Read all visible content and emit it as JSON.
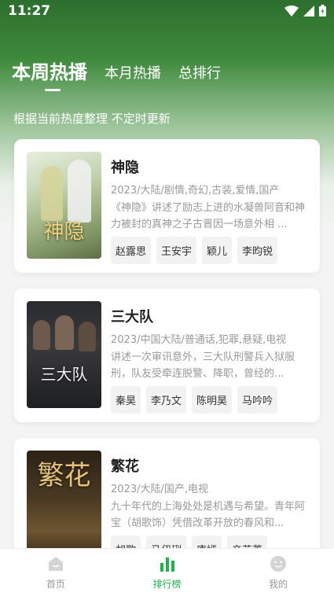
{
  "status_bar": {
    "time": "11:27"
  },
  "tabs": [
    {
      "label": "本周热播"
    },
    {
      "label": "本月热播"
    },
    {
      "label": "总排行"
    }
  ],
  "subtitle": "根据当前热度整理 不定时更新",
  "cards": [
    {
      "title": "神隐",
      "meta": "2023/大陆/剧情,奇幻,古装,爱情,国产",
      "description": "《神隐》讲述了励志上进的水凝兽阿音和神力被封的真神之子古晋因一场意外相 ...",
      "poster_text": "神隐",
      "cast": [
        "赵露思",
        "王安宇",
        "颖儿",
        "李昀锐"
      ]
    },
    {
      "title": "三大队",
      "meta": "2023/中国大陆/普通话,犯罪,悬疑,电视",
      "description": "讲述一次审讯意外，三大队刑警兵入狱服刑，队友受牵连脱警、降职，曾经的...",
      "poster_text": "三大队",
      "cast": [
        "秦昊",
        "李乃文",
        "陈明昊",
        "马吟吟"
      ]
    },
    {
      "title": "繁花",
      "meta": "2023/大陆/国产,电视",
      "description": "九十年代的上海处处是机遇与希望。青年阿宝（胡歌饰）凭借改革开放的春风和...",
      "poster_text": "繁花",
      "cast": [
        "胡歌",
        "马伊琍",
        "唐嫣",
        "辛芷蕾"
      ]
    }
  ],
  "bottom_nav": [
    {
      "label": "首页",
      "icon": "home-icon"
    },
    {
      "label": "排行榜",
      "icon": "ranking-icon"
    },
    {
      "label": "我的",
      "icon": "profile-icon"
    }
  ],
  "colors": {
    "accent": "#22b14c",
    "header_green": "#2c6e2e"
  }
}
